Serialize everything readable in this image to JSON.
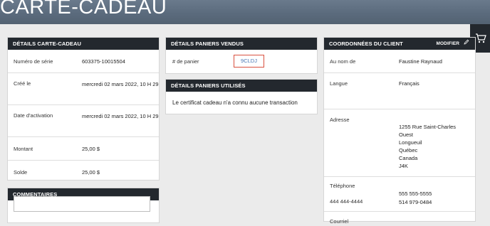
{
  "hero": {
    "title": "CARTE-CADEAU"
  },
  "gift_card_details": {
    "heading": "DÉTAILS CARTE-CADEAU",
    "rows": [
      {
        "label": "Numéro de série",
        "value": "603375-10015504"
      },
      {
        "label": "Créé le",
        "value": "mercredi 02 mars 2022, 10 H 29"
      },
      {
        "label": "Date d'activation",
        "value": "mercredi 02 mars 2022, 10 H 29"
      },
      {
        "label": "Montant",
        "value": "25,00 $"
      },
      {
        "label": "Solde",
        "value": "25,00 $"
      }
    ]
  },
  "comments": {
    "heading": "COMMENTAIRES"
  },
  "sold_baskets": {
    "heading": "DÉTAILS PANIERS VENDUS",
    "label": "# de panier",
    "basket_id": "9CLDJ"
  },
  "used_baskets": {
    "heading": "DÉTAILS PANIERS UTILISÉS",
    "message": "Le certificat cadeau n'a connu aucune transaction"
  },
  "customer": {
    "heading": "COORDONNÉES DU CLIENT",
    "edit_label": "MODIFIER",
    "name_label": "Au nom de",
    "name": "Faustine Raynaud",
    "language_label": "Langue",
    "language": "Français",
    "address_label": "Adresse",
    "address_lines": [
      "1255 Rue Saint-Charles",
      "Ouest",
      "Longueuil",
      "Québec",
      "Canada",
      "J4K"
    ],
    "phone_label": "Téléphone",
    "phone_primary": "555 555-5555",
    "phone_left": "444 444-4444",
    "phone_secondary": "514 979-0484",
    "email_label": "Courriel"
  },
  "icons": {
    "edit": "pencil-icon",
    "cart": "cart-icon"
  }
}
